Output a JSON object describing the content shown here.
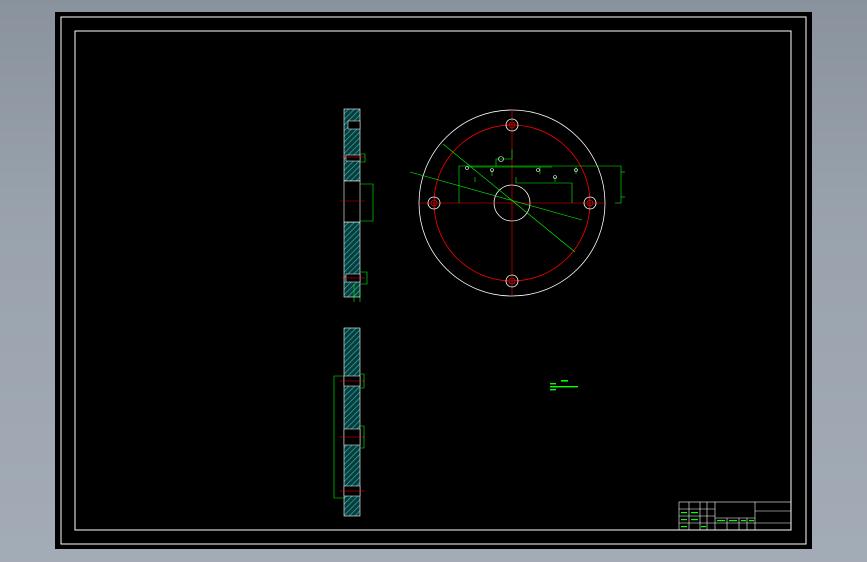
{
  "app": {
    "background_color": "#000000",
    "frame_color": "#ffffff",
    "window_bg": "#9aa3ad"
  },
  "layers": {
    "outline": "#ffffff",
    "center": "#ff0000",
    "dimension": "#00ff00",
    "hatch": "#1fa3a3"
  },
  "icons": {
    "hatch": "section-hatch-pattern"
  }
}
